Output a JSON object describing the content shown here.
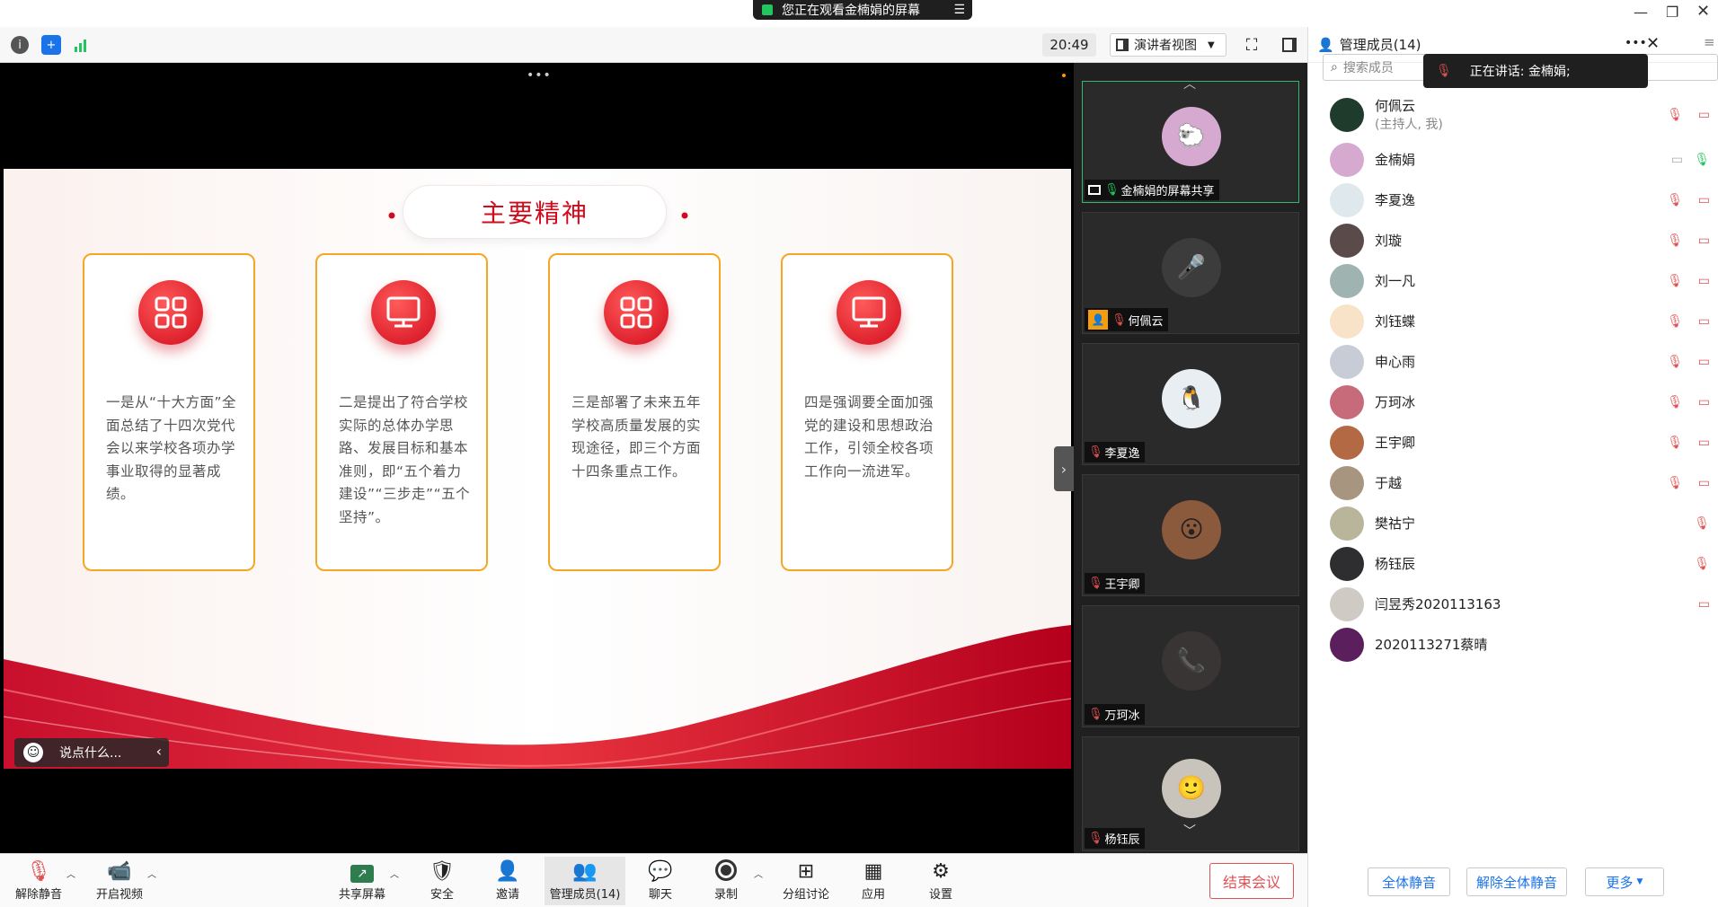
{
  "banner": {
    "text": "您正在观看金楠娟的屏幕"
  },
  "toolbar": {
    "clock": "20:49",
    "view_label": "演讲者视图"
  },
  "slide": {
    "title": "主要精神",
    "cards": [
      {
        "text": "一是从“十大方面”全面总结了十四次党代会以来学校各项办学事业取得的显著成绩。"
      },
      {
        "text": "二是提出了符合学校实际的总体办学思路、发展目标和基本准则，即“五个着力建设”“三步走”“五个坚持”。"
      },
      {
        "text": "三是部署了未来五年学校高质量发展的实现途径，即三个方面十四条重点工作。"
      },
      {
        "text": "四是强调要全面加强党的建设和思想政治工作，引领全校各项工作向一流进军。"
      }
    ]
  },
  "chat": {
    "placeholder": "说点什么..."
  },
  "gallery": {
    "tiles": [
      {
        "name": "金楠娟的屏幕共享"
      },
      {
        "name": "何佩云"
      },
      {
        "name": "李夏逸"
      },
      {
        "name": "王宇卿"
      },
      {
        "name": "万珂冰"
      },
      {
        "name": "杨钰辰"
      }
    ]
  },
  "panel": {
    "title": "管理成员(14)",
    "search_placeholder": "搜索成员",
    "speaking": "正在讲话: 金楠娟;",
    "members": [
      {
        "name": "何佩云",
        "sub": "(主持人, 我)"
      },
      {
        "name": "金楠娟",
        "sub": ""
      },
      {
        "name": "李夏逸",
        "sub": ""
      },
      {
        "name": "刘璇",
        "sub": ""
      },
      {
        "name": "刘一凡",
        "sub": ""
      },
      {
        "name": "刘钰蝶",
        "sub": ""
      },
      {
        "name": "申心雨",
        "sub": ""
      },
      {
        "name": "万珂冰",
        "sub": ""
      },
      {
        "name": "王宇卿",
        "sub": ""
      },
      {
        "name": "于越",
        "sub": ""
      },
      {
        "name": "樊祜宁",
        "sub": ""
      },
      {
        "name": "杨钰辰",
        "sub": ""
      },
      {
        "name": "闫昱秀2020113163",
        "sub": ""
      },
      {
        "name": "2020113271蔡晴",
        "sub": ""
      }
    ],
    "mute_all": "全体静音",
    "unmute_all": "解除全体静音",
    "more": "更多"
  },
  "bottombar": {
    "unmute": "解除静音",
    "video": "开启视频",
    "share": "共享屏幕",
    "security": "安全",
    "invite": "邀请",
    "members": "管理成员(14)",
    "chat": "聊天",
    "record": "录制",
    "breakout": "分组讨论",
    "apps": "应用",
    "settings": "设置",
    "end": "结束会议"
  },
  "colors": {
    "accent": "#1a73e8",
    "brand_red": "#d10b1b",
    "card_border": "#f5a623",
    "danger": "#e05252"
  }
}
